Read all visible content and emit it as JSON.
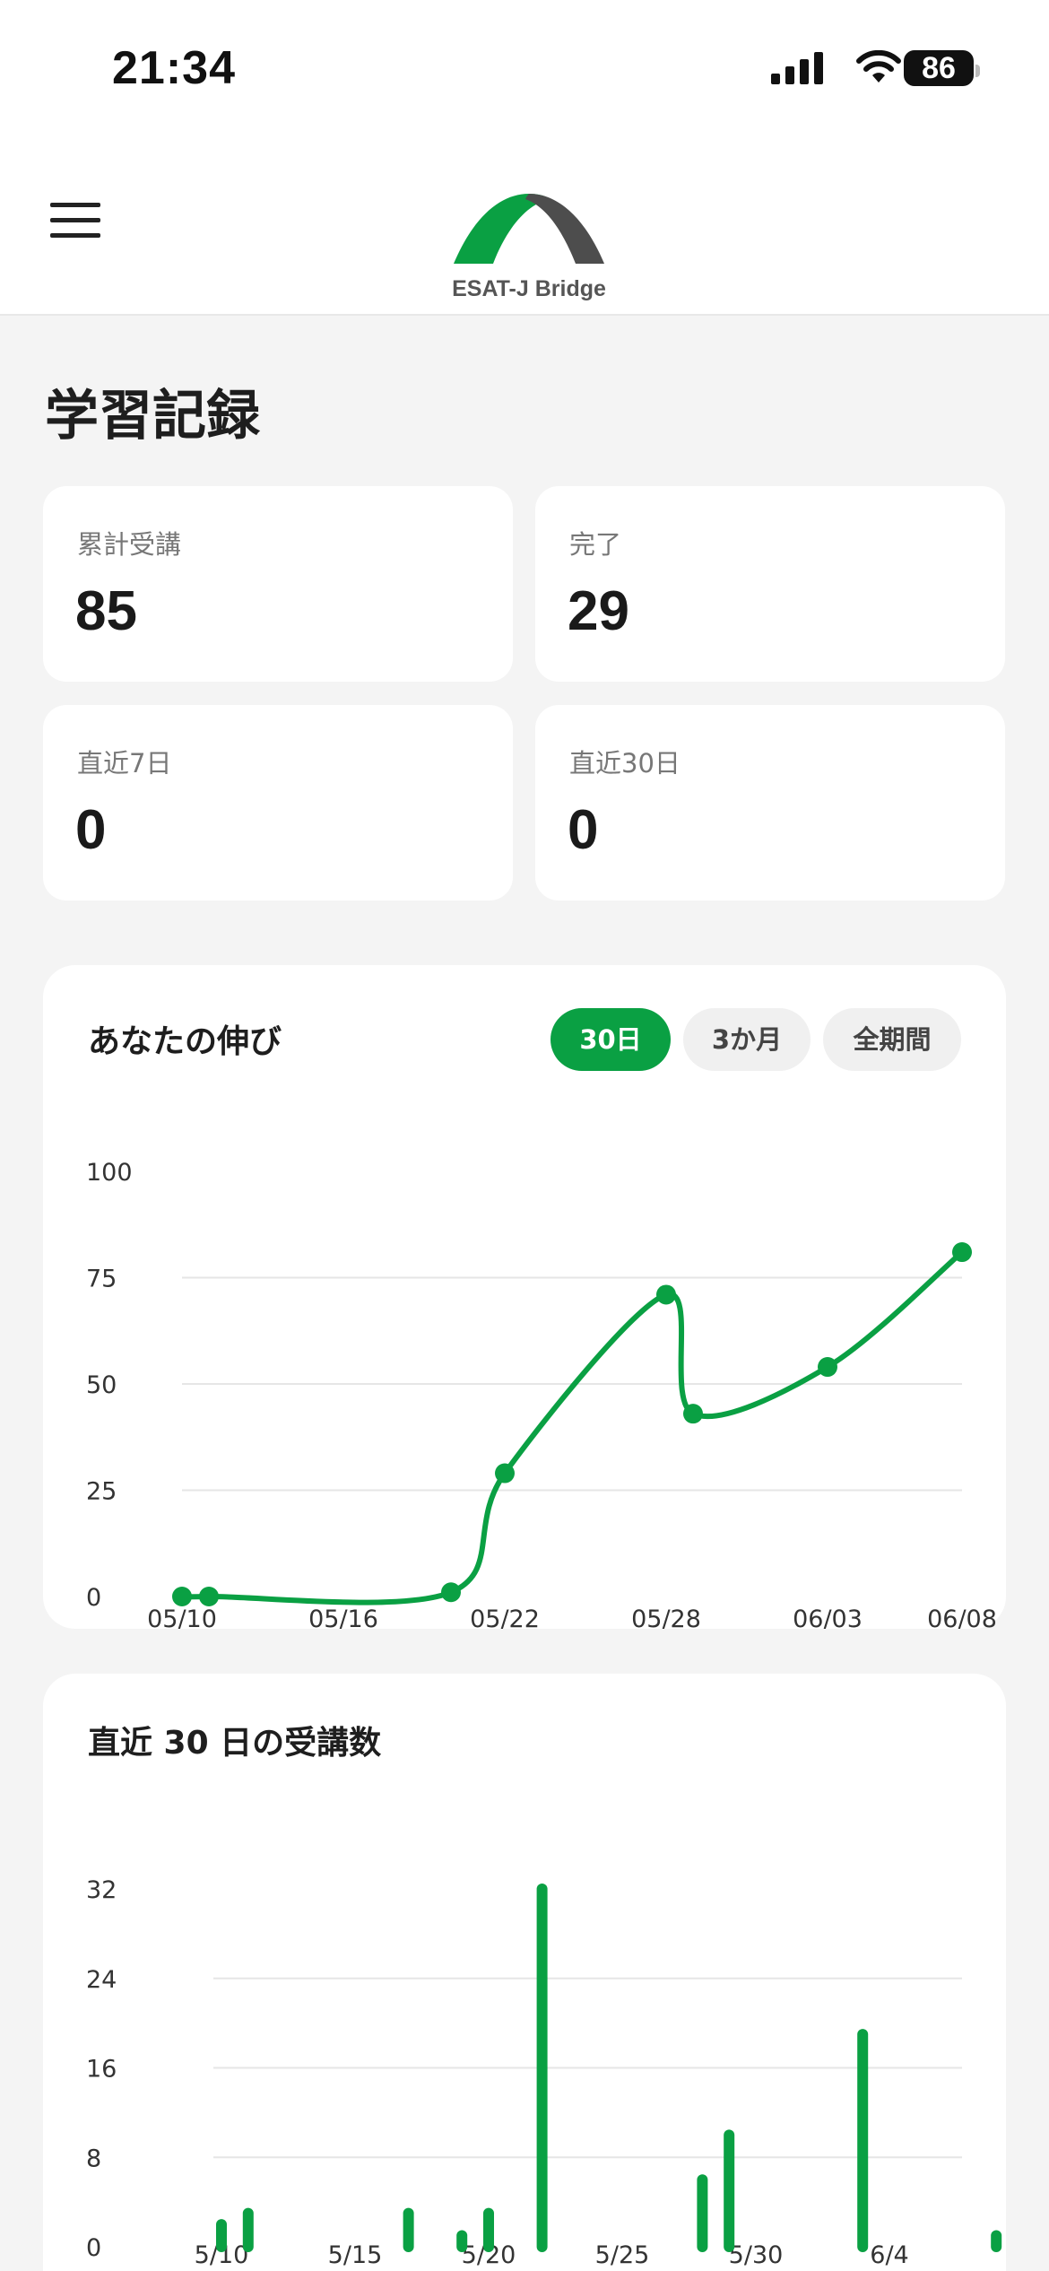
{
  "status_bar": {
    "time": "21:34",
    "battery": "86"
  },
  "header": {
    "logo_text": "ESAT-J Bridge"
  },
  "page": {
    "title": "学習記録"
  },
  "stats": [
    {
      "label": "累計受講",
      "value": "85"
    },
    {
      "label": "完了",
      "value": "29"
    },
    {
      "label": "直近7日",
      "value": "0"
    },
    {
      "label": "直近30日",
      "value": "0"
    }
  ],
  "growth_card": {
    "title": "あなたの伸び",
    "ranges": [
      "30日",
      "3か月",
      "全期間"
    ],
    "selected_range": "30日"
  },
  "sessions_card": {
    "title": "直近 30 日の受講数"
  },
  "colors": {
    "accent": "#0aa043",
    "logo_dark": "#4d4d4d",
    "background": "#f4f4f4"
  },
  "chart_data": [
    {
      "type": "line",
      "x": [
        "05/10",
        "05/11",
        "05/20",
        "05/22",
        "05/28",
        "05/29",
        "06/03",
        "06/08"
      ],
      "values": [
        0,
        0,
        1,
        29,
        71,
        43,
        54,
        81
      ],
      "x_ticks": [
        "05/10",
        "05/16",
        "05/22",
        "05/28",
        "06/03",
        "06/08"
      ],
      "y_ticks": [
        "0",
        "25",
        "50",
        "75",
        "100"
      ],
      "ylim": [
        0,
        100
      ],
      "grid": true
    },
    {
      "type": "bar",
      "x": [
        "5/10",
        "5/11",
        "5/17",
        "5/19",
        "5/20",
        "5/22",
        "5/28",
        "5/29",
        "6/3",
        "6/8"
      ],
      "values": [
        2,
        3,
        3,
        1,
        3,
        32,
        6,
        10,
        19,
        1
      ],
      "x_ticks": [
        "5/10",
        "5/15",
        "5/20",
        "5/25",
        "5/30",
        "6/4"
      ],
      "y_ticks": [
        "0",
        "8",
        "16",
        "24",
        "32"
      ],
      "ylim": [
        0,
        32
      ],
      "grid": true
    }
  ]
}
